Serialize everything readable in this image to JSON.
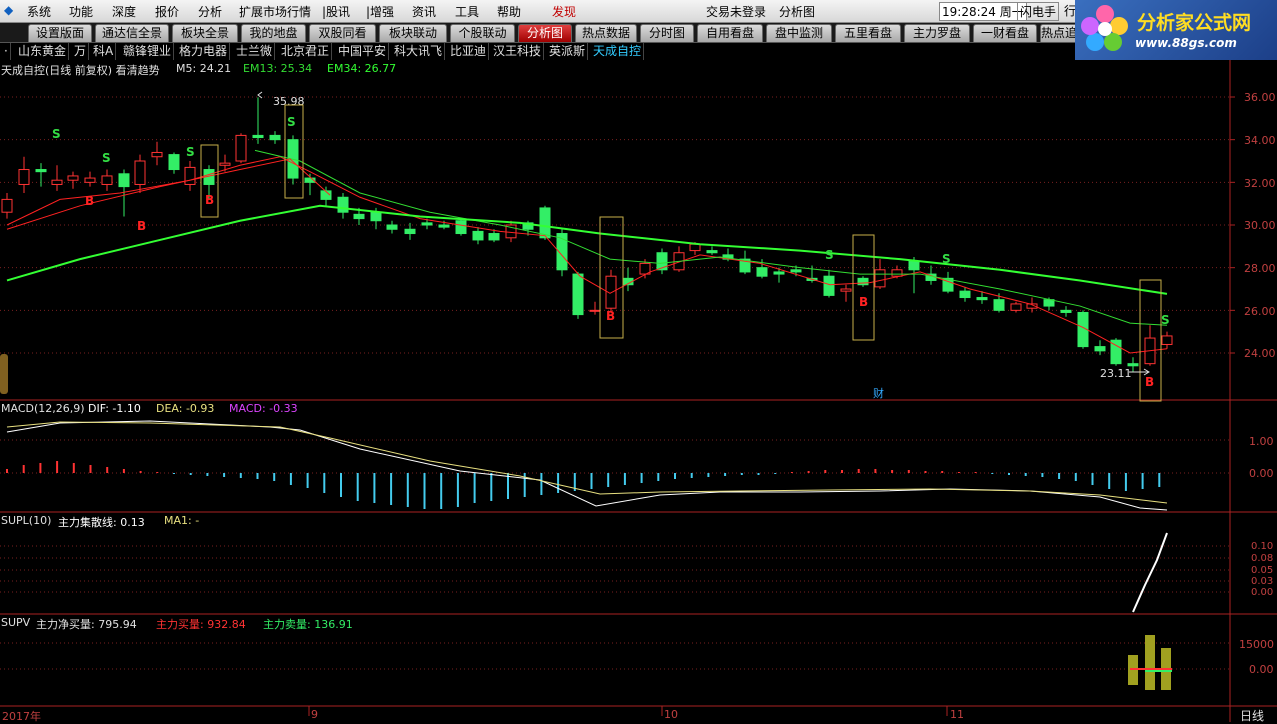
{
  "menu": {
    "items": [
      "系统",
      "功能",
      "深度",
      "报价",
      "分析",
      "扩展市场行情",
      "|股讯",
      "|增强",
      "资讯",
      "工具",
      "帮助",
      "发现"
    ],
    "login": "交易未登录",
    "analysis": "分析图",
    "time": "19:28:24 周一",
    "flash": "闪电手",
    "trade": "行"
  },
  "tabs": [
    "设置版面",
    "通达信全景",
    "板块全景",
    "我的地盘",
    "双股同看",
    "板块联动",
    "个股联动",
    "分析图",
    "热点数据",
    "分时图",
    "自用看盘",
    "盘中监测",
    "五里看盘",
    "主力罗盘",
    "一财看盘",
    "热点追"
  ],
  "active_tab": "分析图",
  "stocks": [
    "·",
    "山东黄金",
    "万",
    "科A",
    "赣锋锂业",
    "格力电器",
    "士兰微",
    "北京君正",
    "中国平安",
    "科大讯飞",
    "比亚迪",
    "汉王科技",
    "英派斯",
    "天成自控"
  ],
  "active_stock": "天成自控",
  "logo": {
    "title": "分析家公式网",
    "url": "www.88gs.com"
  },
  "main": {
    "title": "天成自控(日线 前复权) 看清趋势",
    "m5": "M5: 24.21",
    "em13": "EM13: 25.34",
    "em34": "EM34: 26.77",
    "high_label": "35.98",
    "low_label": "23.11",
    "cai": "财",
    "signal_s": "S",
    "signal_b": "B",
    "y_ticks": [
      "36.00",
      "34.00",
      "32.00",
      "30.00",
      "28.00",
      "26.00",
      "24.00"
    ]
  },
  "macd": {
    "name": "MACD(12,26,9)",
    "dif": "DIF: -1.10",
    "dea": "DEA: -0.93",
    "macd": "MACD: -0.33",
    "y_ticks": [
      "1.00",
      "0.00"
    ]
  },
  "supl": {
    "name": "SUPL(10)",
    "line": "主力集散线: 0.13",
    "ma1": "MA1: -",
    "y_ticks": [
      "0.10",
      "0.08",
      "0.05",
      "0.03",
      "0.00"
    ]
  },
  "supv": {
    "name": "SUPV",
    "net": "主力净买量: 795.94",
    "buy": "主力买量: 932.84",
    "sell": "主力卖量: 136.91",
    "y_ticks": [
      "15000",
      "0.00"
    ]
  },
  "xaxis": {
    "labels": [
      "2017年",
      "9",
      "10",
      "11"
    ],
    "period": "日线"
  },
  "colors": {
    "up": "#ff3333",
    "down": "#33ee66",
    "em34": "#33ff33",
    "m5": "#ff2222",
    "em13": "#33dd33",
    "frame": "#c8b04a",
    "dif": "#ffffff",
    "dea": "#e8e080",
    "axis": "#aa2222"
  }
}
